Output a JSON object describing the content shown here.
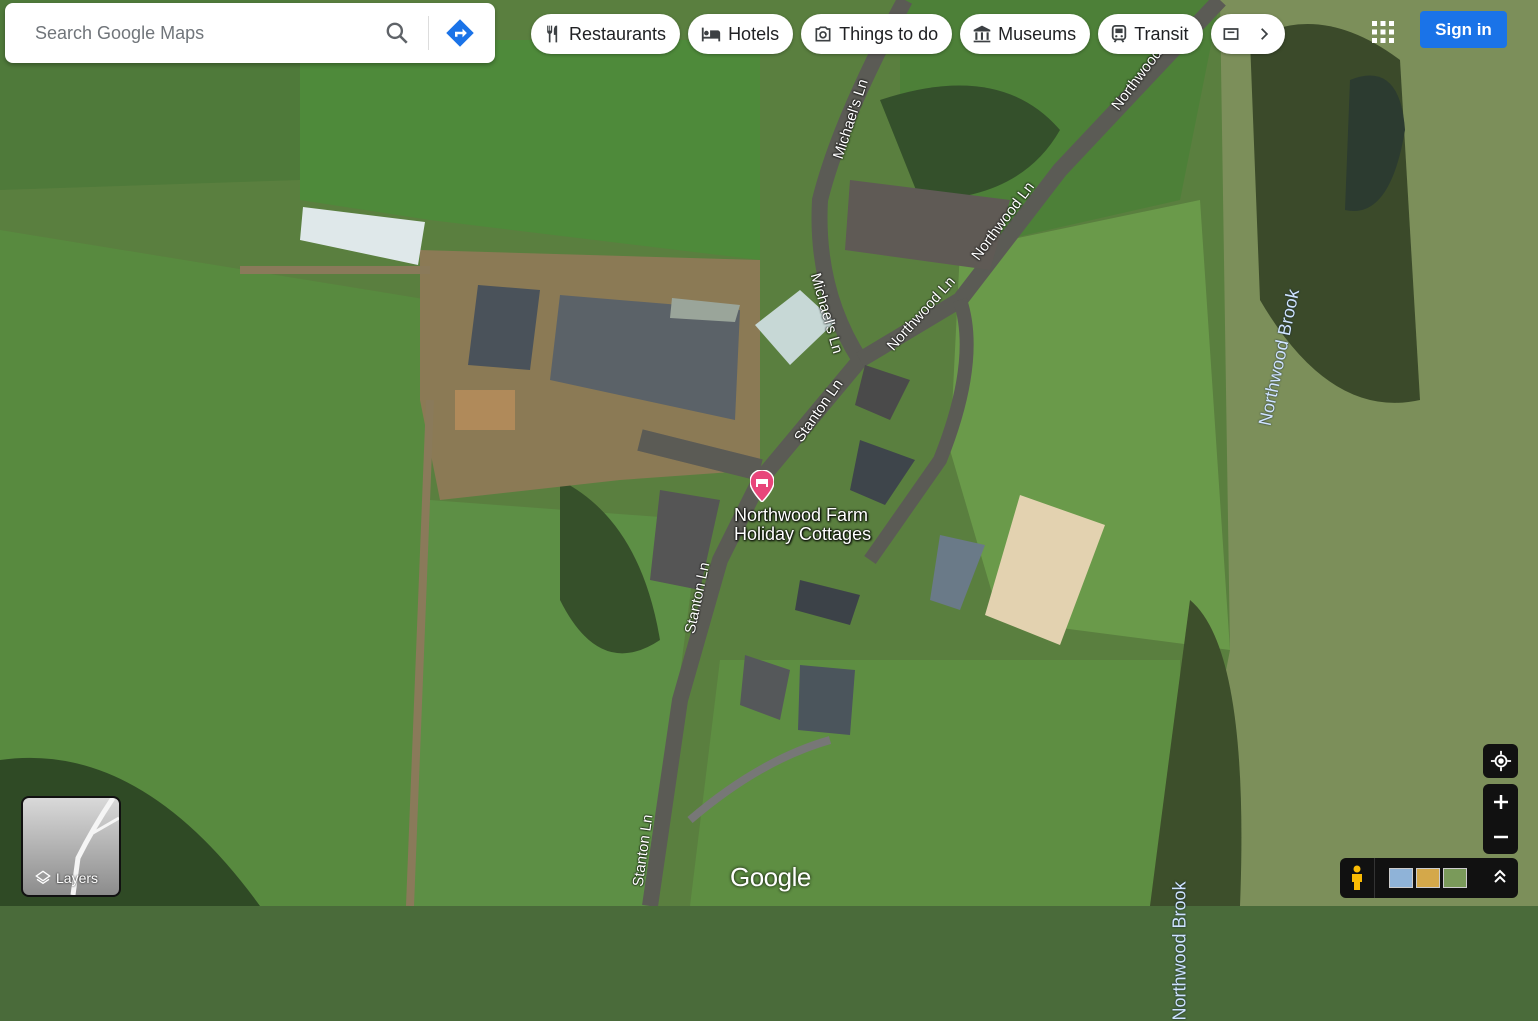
{
  "search": {
    "placeholder": "Search Google Maps"
  },
  "chips": [
    {
      "label": "Restaurants",
      "icon": "fork-knife-icon"
    },
    {
      "label": "Hotels",
      "icon": "bed-icon"
    },
    {
      "label": "Things to do",
      "icon": "camera-icon"
    },
    {
      "label": "Museums",
      "icon": "museum-icon"
    },
    {
      "label": "Transit",
      "icon": "train-icon"
    }
  ],
  "header": {
    "signin_label": "Sign in"
  },
  "place": {
    "name_line1": "Northwood Farm",
    "name_line2": "Holiday Cottages",
    "pin_color": "#e8457a"
  },
  "roads": {
    "michaels_1": "Michael's Ln",
    "michaels_2": "Michael's Ln",
    "northwood_1": "Northwood Ln",
    "northwood_2": "Northwood Ln",
    "northwood_3": "Northwood Ln",
    "stanton_1": "Stanton Ln",
    "stanton_2": "Stanton Ln",
    "stanton_3": "Stanton Ln"
  },
  "water": {
    "brook_1": "Northwood Brook",
    "brook_2": "Northwood Brook"
  },
  "controls": {
    "layers_label": "Layers",
    "logo": "Google"
  },
  "colors": {
    "accent": "#1a73e8"
  }
}
